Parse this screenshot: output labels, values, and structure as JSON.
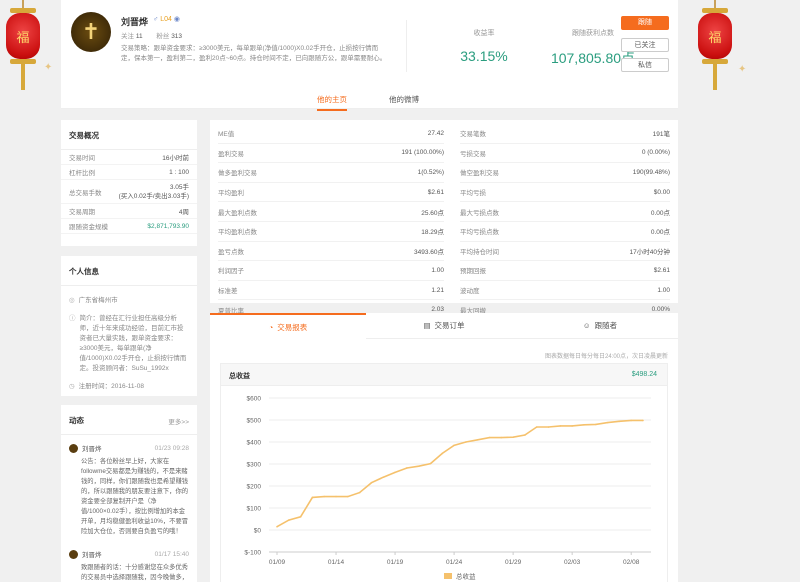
{
  "profile": {
    "username": "刘晋烨",
    "level": "L04",
    "follow_label": "关注",
    "follow_count": "11",
    "fans_label": "粉丝",
    "fans_count": "313",
    "bio": "交易策略：跟单资金要求：≥3000美元，每单跟单(净值/1000)X0.02手开仓，止损按行情而定，保本第一，盈利第二，盈利20点~60点。持仓时间不定，已向跟随方公，跟单需要耐心。",
    "return_rate_label": "收益率",
    "return_rate": "33.15%",
    "profit_points_label": "跟随获利点数",
    "profit_points": "107,805.80点",
    "copy_button": "跟随",
    "followed_button": "已关注",
    "message_button": "私信",
    "tabs": [
      "他的主页",
      "他的微博"
    ]
  },
  "overview": {
    "title": "交易概况",
    "rows": [
      {
        "label": "交易时间",
        "value": "16小时前"
      },
      {
        "label": "杠杆比例",
        "value": "1 : 100"
      },
      {
        "label": "总交易手数",
        "value": "3.05手",
        "value2": "(买入0.02手/卖出3.03手)"
      },
      {
        "label": "交易周期",
        "value": "4周"
      },
      {
        "label": "跟随资金规模",
        "value": "$2,871,793.90"
      }
    ]
  },
  "personal": {
    "title": "个人信息",
    "location": "广东省梅州市",
    "intro_label": "简介：",
    "intro": "曾经在汇行业担任高级分析师，近十年来成功经验，目前汇市投资者已大量实践，跟单资金要求：≥3000美元，每单跟单(净值/1000)X0.02手开仓，止损按行情而定。投资顾问者：SuSu_1992x",
    "register": "注册时间：2016-11-08"
  },
  "news": {
    "title": "动态",
    "more": "更多>>",
    "items": [
      {
        "user": "刘晋烨",
        "time": "01/23 09:28",
        "text": "公告：各位粉丝早上好，大家在followme交易都是为赚钱的，不是来赌钱的，同样，你们跟随我也是希望赚钱的，所以跟随我的朋友要注意下，你的资金要全部复制开户是（净值/1000×0.02手），按比例增加的本金开单，月均稳健盈利收益10%，不要冒险加大仓位，否则要自负盈亏的哦！"
      },
      {
        "user": "刘晋烨",
        "time": "01/17 15:40",
        "text": "致跟随者的话：十分感谢您在众多优秀的交易员中选择跟随我，因今晚做多，进场仍是错误的信号，已及时止损。"
      }
    ]
  },
  "stats": {
    "left": [
      {
        "label": "ME值",
        "value": "27.42"
      },
      {
        "label": "盈利交易",
        "value": "191 (100.00%)"
      },
      {
        "label": "做多盈利交易",
        "value": "1(0.52%)"
      },
      {
        "label": "平均盈利",
        "value": "$2.61"
      },
      {
        "label": "最大盈利点数",
        "value": "25.60点"
      },
      {
        "label": "平均盈利点数",
        "value": "18.29点"
      },
      {
        "label": "盈亏点数",
        "value": "3493.60点"
      },
      {
        "label": "利润因子",
        "value": "1.00"
      },
      {
        "label": "标准差",
        "value": "1.21"
      },
      {
        "label": "夏普比率",
        "value": "2.03"
      }
    ],
    "right": [
      {
        "label": "交易笔数",
        "value": "191笔"
      },
      {
        "label": "亏损交易",
        "value": "0 (0.00%)"
      },
      {
        "label": "做空盈利交易",
        "value": "190(99.48%)"
      },
      {
        "label": "平均亏损",
        "value": "$0.00"
      },
      {
        "label": "最大亏损点数",
        "value": "0.00点"
      },
      {
        "label": "平均亏损点数",
        "value": "0.00点"
      },
      {
        "label": "平均持仓时间",
        "value": "17小时40分钟"
      },
      {
        "label": "预期回报",
        "value": "$2.61"
      },
      {
        "label": "波动度",
        "value": "1.00"
      },
      {
        "label": "最大回撤",
        "value": "0.00%"
      }
    ]
  },
  "chart_panel": {
    "tabs": [
      "交易报表",
      "交易订单",
      "跟随者"
    ],
    "note": "图表数据每日每分每日24:00点，次日凌晨更新",
    "box_title": "总收益",
    "box_total": "$498.24"
  },
  "chart_data": {
    "type": "line",
    "title": "总收益",
    "x": [
      "01/09",
      "01/10",
      "01/11",
      "01/12",
      "01/13",
      "01/14",
      "01/15",
      "01/16",
      "01/17",
      "01/18",
      "01/19",
      "01/20",
      "01/21",
      "01/22",
      "01/23",
      "01/24",
      "01/25",
      "01/26",
      "01/27",
      "01/28",
      "01/29",
      "01/30",
      "01/31",
      "02/01",
      "02/02",
      "02/03",
      "02/04",
      "02/05",
      "02/06",
      "02/07",
      "02/08",
      "02/09"
    ],
    "x_ticks": [
      "01/09",
      "01/14",
      "01/19",
      "01/24",
      "01/29",
      "02/03",
      "02/08"
    ],
    "series": [
      {
        "name": "总收益",
        "color": "#f5c16c",
        "values": [
          15,
          45,
          60,
          148,
          152,
          152,
          152,
          170,
          215,
          240,
          262,
          282,
          290,
          302,
          348,
          385,
          400,
          410,
          420,
          420,
          422,
          432,
          468,
          468,
          473,
          473,
          478,
          480,
          488,
          494,
          498,
          498
        ]
      }
    ],
    "ylim": [
      -100,
      600
    ],
    "yticks": [
      "$-100",
      "$0",
      "$100",
      "$200",
      "$300",
      "$400",
      "$500",
      "$600"
    ],
    "legend": "bottom-center",
    "grid": true
  }
}
